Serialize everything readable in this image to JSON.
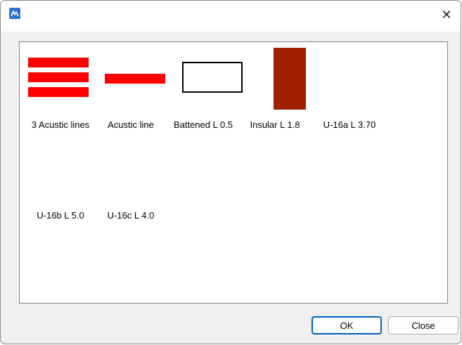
{
  "window": {
    "title": "",
    "close_glyph": "✕"
  },
  "icons": {
    "app": "app-logo-icon",
    "close": "close-icon"
  },
  "colors": {
    "red": "#ff0000",
    "brown": "#a02000",
    "outline": "#000000",
    "accent": "#005fb8"
  },
  "items": [
    {
      "label": "3 Acustic lines"
    },
    {
      "label": "Acustic line"
    },
    {
      "label": "Battened L 0.5"
    },
    {
      "label": "Insular L 1.8"
    },
    {
      "label": "U-16a L 3.70"
    },
    {
      "label": "U-16b L 5.0"
    },
    {
      "label": "U-16c L 4.0"
    }
  ],
  "buttons": {
    "ok": "OK",
    "close": "Close"
  }
}
